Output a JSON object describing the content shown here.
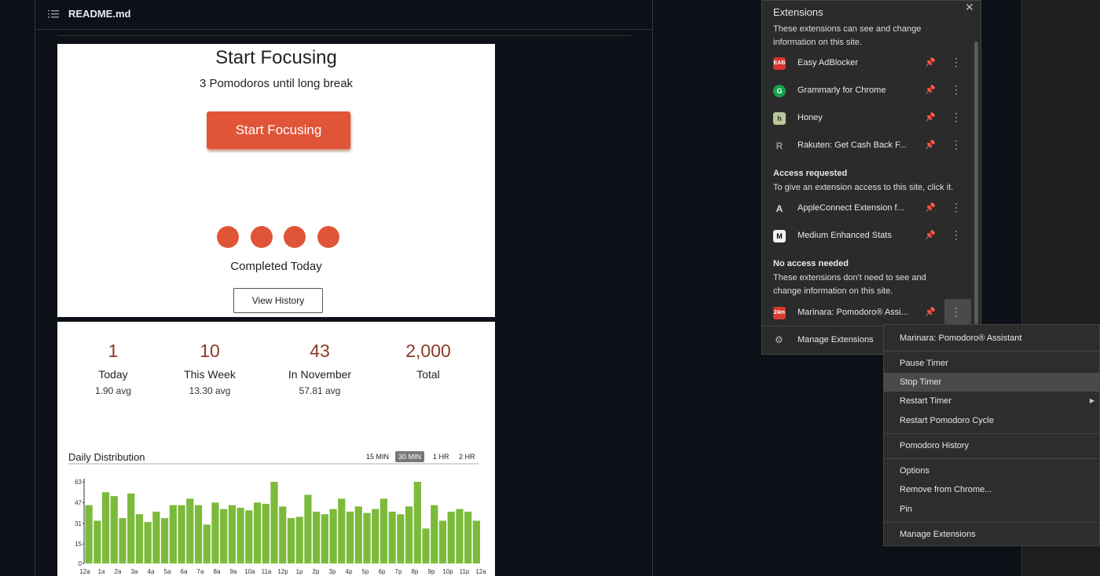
{
  "readme": {
    "filename": "README.md"
  },
  "focus": {
    "title": "Start Focusing",
    "subtitle": "3 Pomodoros until long break",
    "start_button": "Start Focusing",
    "dots_completed": 4,
    "completed_label": "Completed Today",
    "view_history": "View History"
  },
  "stats": [
    {
      "num": "1",
      "label": "Today",
      "avg": "1.90 avg"
    },
    {
      "num": "10",
      "label": "This Week",
      "avg": "13.30 avg"
    },
    {
      "num": "43",
      "label": "In November",
      "avg": "57.81 avg"
    },
    {
      "num": "2,000",
      "label": "Total",
      "avg": ""
    }
  ],
  "distribution": {
    "title": "Daily Distribution",
    "segments": [
      "15 MIN",
      "30 MIN",
      "1 HR",
      "2 HR"
    ],
    "active_segment": "30 MIN"
  },
  "chart_data": {
    "type": "bar",
    "title": "Daily Distribution",
    "xlabel": "",
    "ylabel": "",
    "ylim": [
      0,
      63
    ],
    "yticks": [
      0,
      15,
      31,
      47,
      63
    ],
    "xticks": [
      "12a",
      "1a",
      "2a",
      "3a",
      "4a",
      "5a",
      "6a",
      "7a",
      "8a",
      "9a",
      "10a",
      "11a",
      "12p",
      "1p",
      "2p",
      "3p",
      "4p",
      "5p",
      "6p",
      "7p",
      "8p",
      "9p",
      "10p",
      "11p",
      "12a"
    ],
    "values": [
      45,
      33,
      55,
      52,
      35,
      54,
      38,
      32,
      40,
      35,
      45,
      45,
      50,
      45,
      30,
      47,
      42,
      45,
      43,
      41,
      47,
      46,
      63,
      44,
      35,
      36,
      53,
      40,
      38,
      42,
      50,
      40,
      44,
      39,
      42,
      50,
      40,
      38,
      44,
      63,
      27,
      45,
      33,
      40,
      42,
      40,
      33
    ],
    "bar_color": "#7cba3c"
  },
  "extensions": {
    "title": "Extensions",
    "intro": "These extensions can see and change information on this site.",
    "full_access": [
      {
        "name": "Easy AdBlocker",
        "icon": "easy-adblocker-icon",
        "color": "#d8342a",
        "glyph": "EAB"
      },
      {
        "name": "Grammarly for Chrome",
        "icon": "grammarly-icon",
        "color": "#15a34a",
        "glyph": "G"
      },
      {
        "name": "Honey",
        "icon": "honey-icon",
        "color": "#b9c79a",
        "glyph": "h"
      },
      {
        "name": "Rakuten: Get Cash Back F...",
        "icon": "rakuten-icon",
        "color": "#2b2b2b",
        "glyph": "R"
      }
    ],
    "requested_title": "Access requested",
    "requested_note": "To give an extension access to this site, click it.",
    "requested": [
      {
        "name": "AppleConnect Extension f...",
        "icon": "appleconnect-icon",
        "color": "#2b2b2b",
        "glyph": "A"
      },
      {
        "name": "Medium Enhanced Stats",
        "icon": "medium-icon",
        "color": "#f2f2f2",
        "glyph": "M"
      }
    ],
    "no_access_title": "No access needed",
    "no_access_note": "These extensions don't need to see and change information on this site.",
    "no_access": [
      {
        "name": "Marinara: Pomodoro® Assi...",
        "icon": "marinara-icon",
        "color": "#d93a2b",
        "glyph": "24m"
      }
    ],
    "manage": "Manage Extensions"
  },
  "context_menu": {
    "header": "Marinara: Pomodoro® Assistant",
    "items": [
      "Pause Timer",
      "Stop Timer",
      "Restart Timer",
      "Restart Pomodoro Cycle",
      "Pomodoro History",
      "Options",
      "Remove from Chrome...",
      "Pin",
      "Manage Extensions"
    ],
    "highlighted": "Stop Timer"
  }
}
